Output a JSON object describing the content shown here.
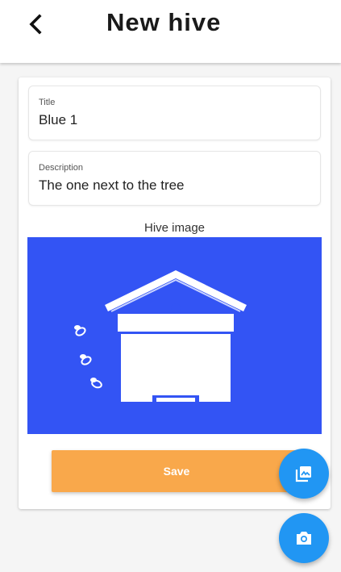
{
  "header": {
    "title": "New hive",
    "back_icon": "back-arrow-icon"
  },
  "form": {
    "title_field": {
      "label": "Title",
      "value": "Blue 1"
    },
    "description_field": {
      "label": "Description",
      "value": "The one next to the tree"
    },
    "image_label": "Hive image",
    "save_label": "Save"
  },
  "fabs": {
    "gallery_icon": "gallery-icon",
    "camera_icon": "camera-icon"
  },
  "colors": {
    "image_background": "#3354f4",
    "save_button": "#f9a84b",
    "fab": "#2196f3"
  }
}
